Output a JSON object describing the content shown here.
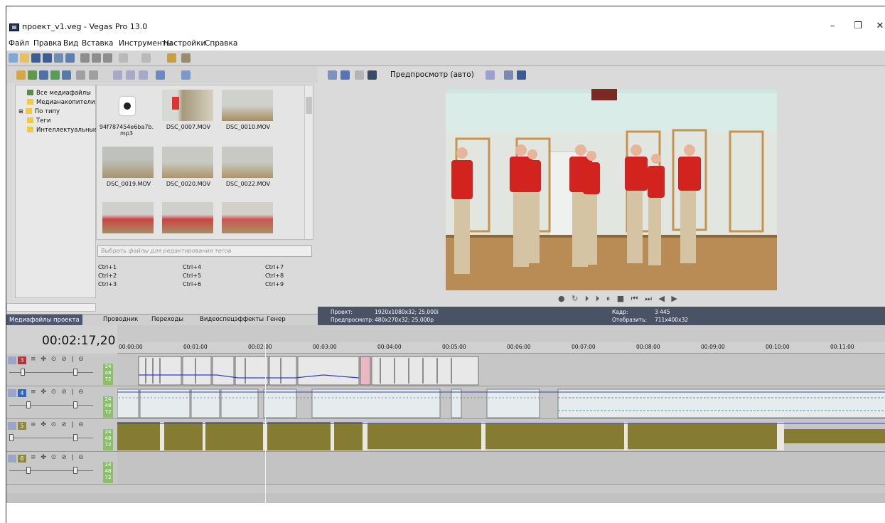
{
  "window": {
    "title": "проект_v1.veg - Vegas Pro 13.0",
    "controls": [
      "–",
      "❐",
      "✕"
    ]
  },
  "menu": [
    "Файл",
    "Правка",
    "Вид",
    "Вставка",
    "Инструменты",
    "Настройки",
    "Справка"
  ],
  "explorer": {
    "tree": [
      "Все медиафайлы",
      "Медианакопители",
      "По типу",
      "Теги",
      "Интеллектуальные"
    ],
    "thumbnails": [
      "94f787454e6ba7b.mp3",
      "DSC_0007.MOV",
      "DSC_0010.MOV",
      "DSC_0019.MOV",
      "DSC_0020.MOV",
      "DSC_0022.MOV"
    ],
    "tag_placeholder": "Выбрать файлы для редактирования тегов",
    "shortcuts": [
      "Ctrl+1",
      "Ctrl+4",
      "Ctrl+7",
      "Ctrl+2",
      "Ctrl+5",
      "Ctrl+8",
      "Ctrl+3",
      "Ctrl+6",
      "Ctrl+9"
    ],
    "tabs": [
      "Медиафайлы проекта",
      "Проводник",
      "Переходы",
      "Видеоспецэффекты",
      "Генер"
    ]
  },
  "preview": {
    "mode_label": "Предпросмотр (авто)",
    "project_label": "Проект:",
    "project_value": "1920x1080x32; 25,000i",
    "preview_label": "Предпросмотр:",
    "preview_value": "480x270x32; 25,000p",
    "frame_label": "Кадр:",
    "frame_value": "3 445",
    "display_label": "Отобразить:",
    "display_value": "711x400x32"
  },
  "timeline": {
    "timecode": "00:02:17,20",
    "ruler": [
      "00:00:00",
      "00:01:00",
      "00:02:00",
      "00:03:00",
      "00:04:00",
      "00:05:00",
      "00:06:00",
      "00:07:00",
      "00:08:00",
      "00:09:00",
      "00:10:00",
      "00:11:00"
    ],
    "tracks": [
      {
        "num": "3",
        "color": "#b8323c"
      },
      {
        "num": "4",
        "color": "#2f6ab8"
      },
      {
        "num": "5",
        "color": "#8f8a3a"
      },
      {
        "num": "6",
        "color": "#8f8a3a"
      }
    ],
    "meter_values": [
      "24",
      "48",
      "72"
    ]
  }
}
